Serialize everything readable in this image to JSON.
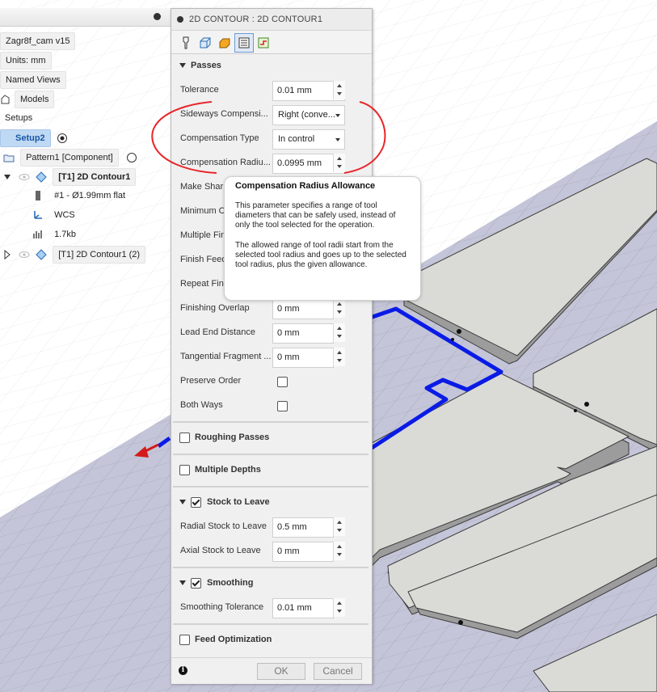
{
  "browser": {
    "doc_name": "Zagr8f_cam v15",
    "units": "Units: mm",
    "named_views": "Named Views",
    "models": "Models",
    "setups": "Setups",
    "setup2": "Setup2",
    "pattern": "Pattern1 [Component]",
    "op1": "[T1] 2D Contour1",
    "tool": "#1 - Ø1.99mm flat",
    "wcs": "WCS",
    "size": "1.7kb",
    "op2": "[T1] 2D Contour1 (2)"
  },
  "dialog": {
    "title": "2D CONTOUR : 2D CONTOUR1",
    "tabs": [
      "tool-icon",
      "geometry-icon",
      "heights-icon",
      "passes-icon",
      "linking-icon"
    ],
    "passes_header": "Passes",
    "tolerance_label": "Tolerance",
    "tolerance_value": "0.01 mm",
    "sideways_label": "Sideways Compensi...",
    "sideways_value": "Right (conve...",
    "comp_type_label": "Compensation Type",
    "comp_type_value": "In control",
    "comp_radius_label": "Compensation Radiu...",
    "comp_radius_value": "0.0995 mm",
    "make_sharp_label": "Make Sharp",
    "minimum_label": "Minimum Cu",
    "multiple_finish_label": "Multiple Fini",
    "finish_feed_label": "Finish Feed",
    "repeat_finish_label": "Repeat Fini",
    "finishing_overlap_label": "Finishing Overlap",
    "finishing_overlap_value": "0 mm",
    "lead_end_label": "Lead End Distance",
    "lead_end_value": "0 mm",
    "tangential_label": "Tangential Fragment ...",
    "tangential_value": "0 mm",
    "preserve_order_label": "Preserve Order",
    "both_ways_label": "Both Ways",
    "roughing_header": "Roughing Passes",
    "multiple_depths_header": "Multiple Depths",
    "stock_header": "Stock to Leave",
    "radial_stock_label": "Radial Stock to Leave",
    "radial_stock_value": "0.5 mm",
    "axial_stock_label": "Axial Stock to Leave",
    "axial_stock_value": "0 mm",
    "smoothing_header": "Smoothing",
    "smoothing_tol_label": "Smoothing Tolerance",
    "smoothing_tol_value": "0.01 mm",
    "feed_opt_header": "Feed Optimization",
    "ok_label": "OK",
    "cancel_label": "Cancel"
  },
  "tooltip": {
    "title": "Compensation Radius Allowance",
    "p1": "This parameter specifies a range of tool diameters that can be safely used, instead of only the tool selected for the operation.",
    "p2": "The allowed range of tool radii start from the selected tool radius and goes up to the selected tool radius, plus the given allowance."
  },
  "colors": {
    "toolpath": "#0a1be6",
    "annotation": "#e8262a",
    "selection": "#bfd9f4"
  }
}
